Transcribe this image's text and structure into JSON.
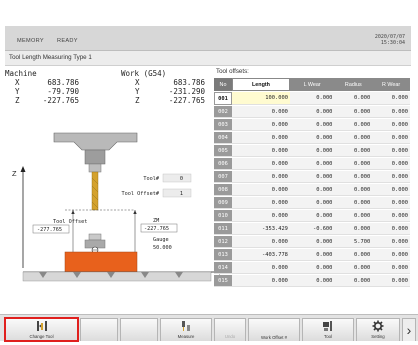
{
  "header": {
    "mode": "MEMORY",
    "status": "READY",
    "date": "2020/07/07",
    "time": "15:30:04"
  },
  "title": "Tool Length Measuring Type 1",
  "coords": {
    "machine_label": "Machine",
    "work_label": "Work (G54)",
    "machine": [
      {
        "axis": "X",
        "value": "683.786"
      },
      {
        "axis": "Y",
        "value": "-79.790"
      },
      {
        "axis": "Z",
        "value": "-227.765"
      }
    ],
    "work": [
      {
        "axis": "X",
        "value": "683.786"
      },
      {
        "axis": "Y",
        "value": "-231.290"
      },
      {
        "axis": "Z",
        "value": "-227.765"
      }
    ]
  },
  "diagram": {
    "z_axis": "Z",
    "tool_label": "Tool#",
    "tool_value": "0",
    "tool_offset_label": "Tool Offset#",
    "tool_offset_value": "1",
    "offset_label": "Tool Offset",
    "offset_value": "-277.765",
    "zm_label": "ZM",
    "zm_value": "-227.765",
    "gauge_label": "Gauge",
    "gauge_value": "50.000"
  },
  "offsets": {
    "label": "Tool offsets:",
    "columns": [
      "No",
      "Length",
      "L Wear",
      "Radius",
      "R Wear"
    ],
    "selected_column": "Length",
    "active_row": "001",
    "rows": [
      {
        "no": "001",
        "length": "100.000",
        "lwear": "0.000",
        "radius": "0.000",
        "rwear": "0.000"
      },
      {
        "no": "002",
        "length": "0.000",
        "lwear": "0.000",
        "radius": "0.000",
        "rwear": "0.000"
      },
      {
        "no": "003",
        "length": "0.000",
        "lwear": "0.000",
        "radius": "0.000",
        "rwear": "0.000"
      },
      {
        "no": "004",
        "length": "0.000",
        "lwear": "0.000",
        "radius": "0.000",
        "rwear": "0.000"
      },
      {
        "no": "005",
        "length": "0.000",
        "lwear": "0.000",
        "radius": "0.000",
        "rwear": "0.000"
      },
      {
        "no": "006",
        "length": "0.000",
        "lwear": "0.000",
        "radius": "0.000",
        "rwear": "0.000"
      },
      {
        "no": "007",
        "length": "0.000",
        "lwear": "0.000",
        "radius": "0.000",
        "rwear": "0.000"
      },
      {
        "no": "008",
        "length": "0.000",
        "lwear": "0.000",
        "radius": "0.000",
        "rwear": "0.000"
      },
      {
        "no": "009",
        "length": "0.000",
        "lwear": "0.000",
        "radius": "0.000",
        "rwear": "0.000"
      },
      {
        "no": "010",
        "length": "0.000",
        "lwear": "0.000",
        "radius": "0.000",
        "rwear": "0.000"
      },
      {
        "no": "011",
        "length": "-353.429",
        "lwear": "-0.600",
        "radius": "0.000",
        "rwear": "0.000"
      },
      {
        "no": "012",
        "length": "0.000",
        "lwear": "0.000",
        "radius": "5.700",
        "rwear": "0.000"
      },
      {
        "no": "013",
        "length": "-403.778",
        "lwear": "0.000",
        "radius": "0.000",
        "rwear": "0.000"
      },
      {
        "no": "014",
        "length": "0.000",
        "lwear": "0.000",
        "radius": "0.000",
        "rwear": "0.000"
      },
      {
        "no": "015",
        "length": "0.000",
        "lwear": "0.000",
        "radius": "0.000",
        "rwear": "0.000"
      }
    ]
  },
  "softkeys": [
    {
      "label": "Change Tool",
      "icon": "change-tool-icon",
      "highlighted": true,
      "enabled": true
    },
    {
      "label": "",
      "icon": "",
      "highlighted": false,
      "enabled": true
    },
    {
      "label": "",
      "icon": "",
      "highlighted": false,
      "enabled": true
    },
    {
      "label": "Measure",
      "icon": "measure-icon",
      "highlighted": false,
      "enabled": true
    },
    {
      "label": "Undo",
      "icon": "",
      "highlighted": false,
      "enabled": false
    },
    {
      "label": "Work Offset #",
      "icon": "",
      "highlighted": false,
      "enabled": true
    },
    {
      "label": "Tool",
      "icon": "tool-icon",
      "highlighted": false,
      "enabled": true
    },
    {
      "label": "Setting",
      "icon": "gear-icon",
      "highlighted": false,
      "enabled": true
    }
  ],
  "next_page": "›",
  "colors": {
    "workpiece": "#e8611c",
    "highlight": "#e0201e",
    "header_bg": "#d7d7d7",
    "active_length_bg": "#fffbd0"
  }
}
